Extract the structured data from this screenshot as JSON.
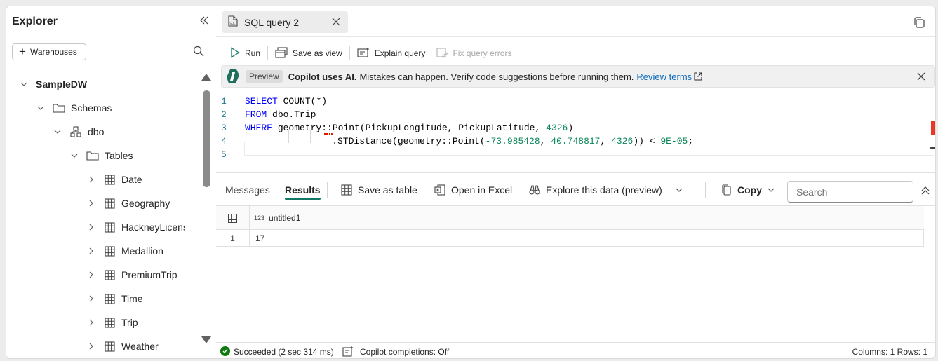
{
  "explorer": {
    "title": "Explorer",
    "add_button_label": "Warehouses",
    "tree": {
      "root": "SampleDW",
      "schemas": "Schemas",
      "schema": "dbo",
      "tables_folder": "Tables",
      "tables": [
        "Date",
        "Geography",
        "HackneyLicens",
        "Medallion",
        "PremiumTrip",
        "Time",
        "Trip",
        "Weather"
      ]
    }
  },
  "tab": {
    "label": "SQL query 2"
  },
  "toolbar": {
    "run": "Run",
    "save_as_view": "Save as view",
    "explain_query": "Explain query",
    "fix_query_errors": "Fix query errors"
  },
  "banner": {
    "pill": "Preview",
    "bold": "Copilot uses AI.",
    "text": "Mistakes can happen. Verify code suggestions before running them.",
    "link": "Review terms"
  },
  "editor": {
    "line_numbers": [
      "1",
      "2",
      "3",
      "4",
      "5"
    ],
    "line1": {
      "kw": "SELECT",
      "fn": "COUNT",
      "rest": "(*)"
    },
    "line2": {
      "kw": "FROM",
      "rest": " dbo.Trip"
    },
    "line3": {
      "kw": "WHERE",
      "rest": " geometry::Point(PickupLongitude, PickupLatitude, ",
      "num": "4326",
      "tail": ")"
    },
    "line4": {
      "a": "    .STDistance(geometry::Point(",
      "n1": "-73.985428",
      "b": ", ",
      "n2": "40.748817",
      "c": ", ",
      "n3": "4326",
      "d": ")) < ",
      "n4": "9E-05",
      "e": ";"
    }
  },
  "results": {
    "tab_messages": "Messages",
    "tab_results": "Results",
    "save_as_table": "Save as table",
    "open_in_excel": "Open in Excel",
    "explore": "Explore this data (preview)",
    "copy": "Copy",
    "search_placeholder": "Search",
    "columns": [
      {
        "type_badge": "123",
        "name": "untitled1"
      }
    ],
    "rows": [
      {
        "n": "1",
        "values": [
          "17"
        ]
      }
    ]
  },
  "status": {
    "result": "Succeeded (2 sec 314 ms)",
    "copilot": "Copilot completions: Off",
    "summary": "Columns: 1 Rows: 1"
  }
}
